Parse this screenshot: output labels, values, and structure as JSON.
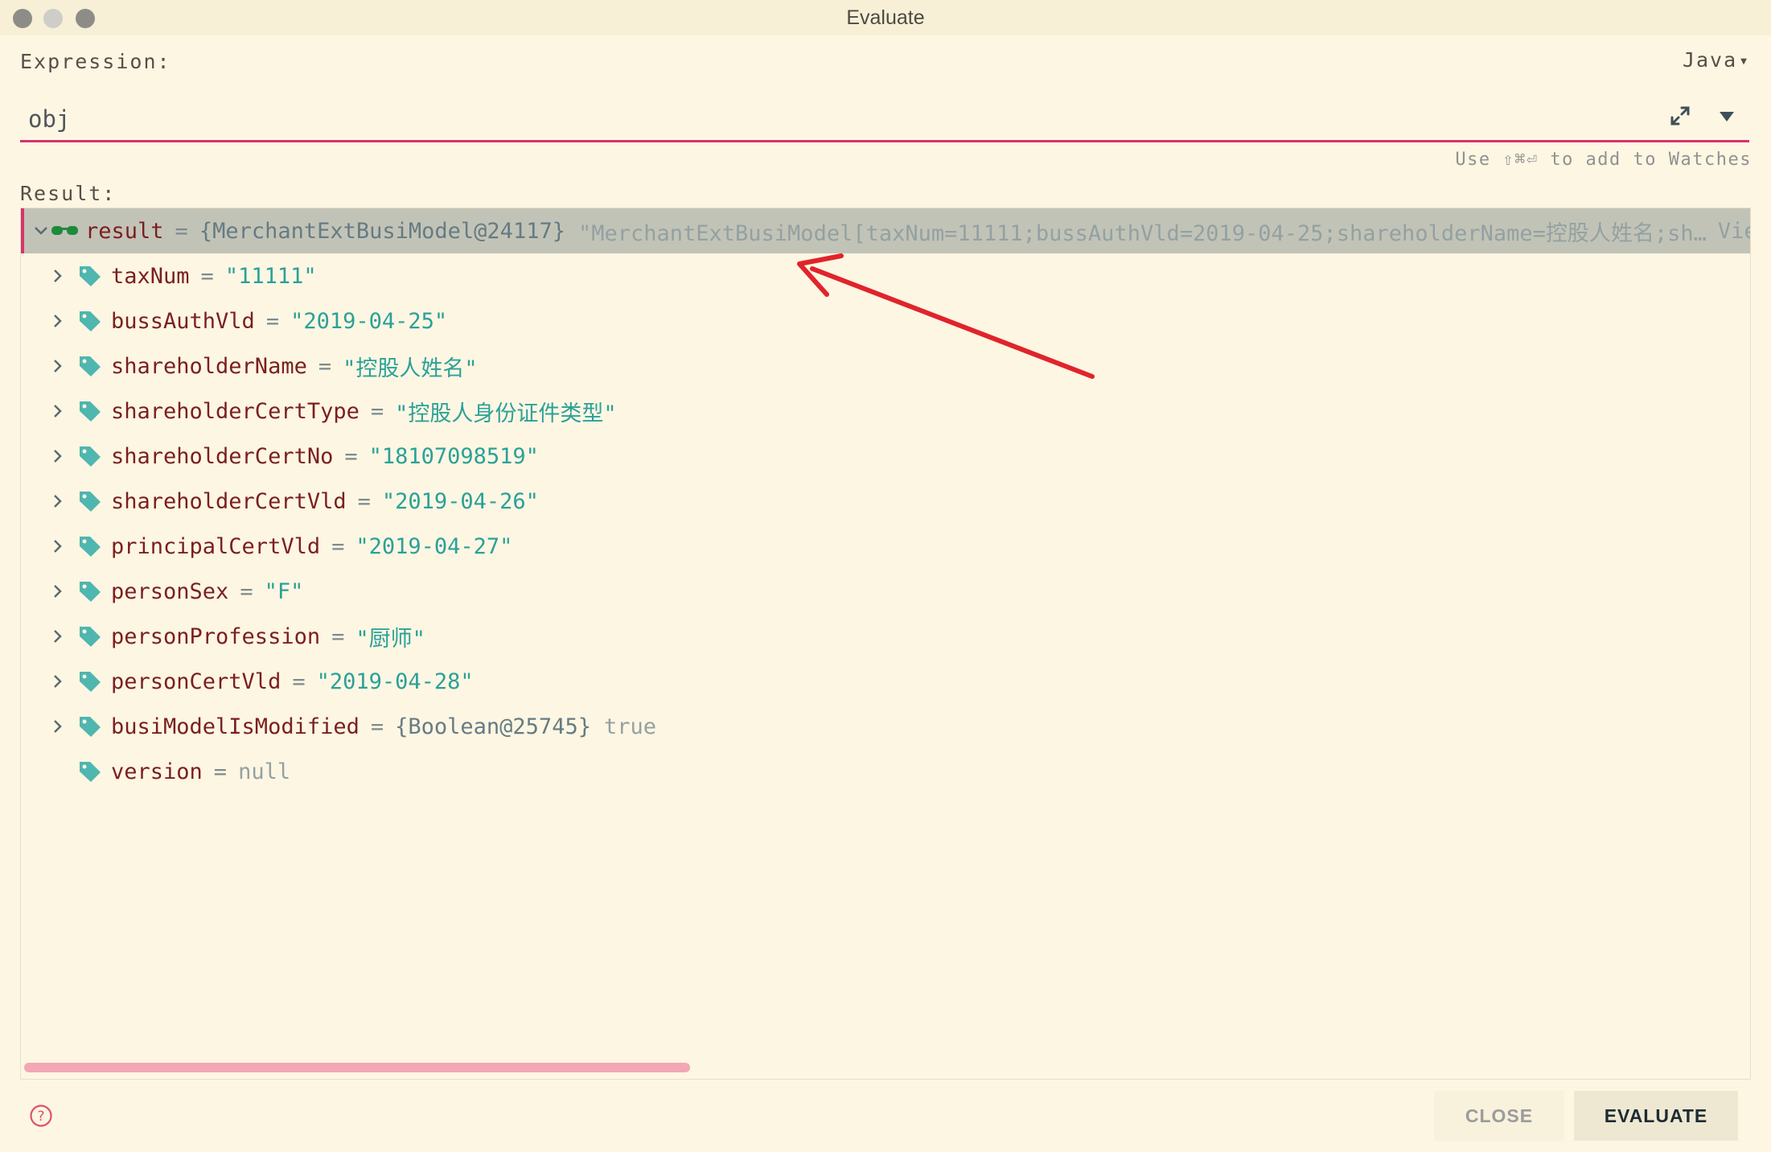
{
  "window": {
    "title": "Evaluate"
  },
  "expression": {
    "label": "Expression:",
    "value": "obj",
    "language": "Java"
  },
  "hint": "Use ⇧⌘⏎ to add to Watches",
  "result": {
    "label": "Result:",
    "root": {
      "name": "result",
      "eq": "=",
      "type": "{MerchantExtBusiModel@24117}",
      "summary": "\"MerchantExtBusiModel[taxNum=11111;bussAuthVld=2019-04-25;shareholderName=控股人姓名;sh…",
      "view": "View"
    },
    "fields": [
      {
        "name": "taxNum",
        "eq": "=",
        "value": "\"11111\""
      },
      {
        "name": "bussAuthVld",
        "eq": "=",
        "value": "\"2019-04-25\""
      },
      {
        "name": "shareholderName",
        "eq": "=",
        "value": "\"控股人姓名\""
      },
      {
        "name": "shareholderCertType",
        "eq": "=",
        "value": "\"控股人身份证件类型\""
      },
      {
        "name": "shareholderCertNo",
        "eq": "=",
        "value": "\"18107098519\""
      },
      {
        "name": "shareholderCertVld",
        "eq": "=",
        "value": "\"2019-04-26\""
      },
      {
        "name": "principalCertVld",
        "eq": "=",
        "value": "\"2019-04-27\""
      },
      {
        "name": "personSex",
        "eq": "=",
        "value": "\"F\""
      },
      {
        "name": "personProfession",
        "eq": "=",
        "value": "\"厨师\""
      },
      {
        "name": "personCertVld",
        "eq": "=",
        "value": "\"2019-04-28\""
      },
      {
        "name": "busiModelIsModified",
        "eq": "=",
        "type": "{Boolean@25745}",
        "value": "true"
      },
      {
        "name": "version",
        "eq": "=",
        "value": "null"
      }
    ]
  },
  "buttons": {
    "close": "CLOSE",
    "evaluate": "EVALUATE"
  },
  "colors": {
    "accent": "#d6336c",
    "string": "#2aa198",
    "field_name": "#7a1f1f",
    "tag_icon": "#4fb6b0",
    "annotation_arrow": "#e0242b"
  },
  "icons": {
    "field": "tag-icon",
    "root": "watch-glasses-icon",
    "expand": "expand-icon",
    "help": "help-icon"
  }
}
